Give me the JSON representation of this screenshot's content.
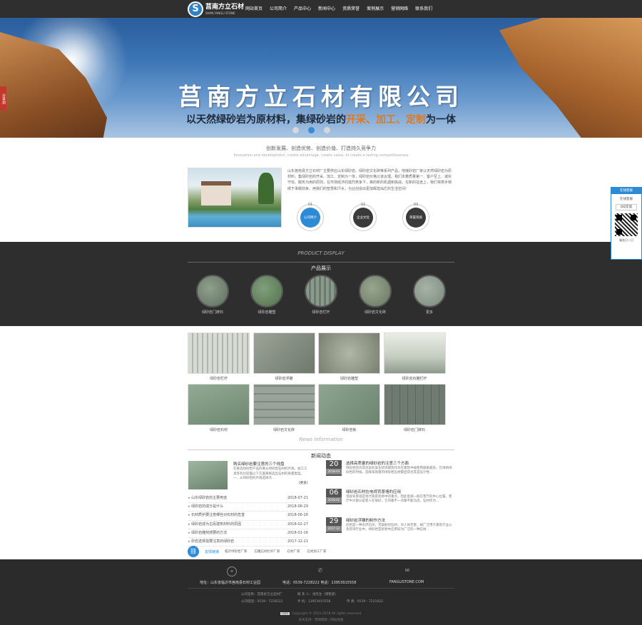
{
  "header": {
    "logo_cn": "莒南方立石材",
    "logo_en": "SHAN FANGLI STONE",
    "logo_mark": "S",
    "nav": [
      "网站首页",
      "公司简介",
      "产品中心",
      "新闻中心",
      "资质荣誉",
      "案例展示",
      "营销网络",
      "联系我们"
    ]
  },
  "banner": {
    "title": "莒南方立石材有限公司",
    "sub_before": "以天然绿砂岩为原材料，集绿砂岩的",
    "sub_highlight": "开采、加工、定制",
    "sub_after": "为一体",
    "share_label": "分享到"
  },
  "slogan": {
    "cn": "创新发展、创造优势、创造价值、打造持久竞争力",
    "en": "Innovation and development, create advantage, create value, to create a lasting competitiveness"
  },
  "about": {
    "text": "山东莒南县方立石材厂主要供应山东绿砂岩、绿砂岩文化砖等系列产品，地接砂岩厂家以天然绿砂岩为原材料，集绿砂岩的开采、加工、定制为一体，绿砂岩价格公道合理。我们本着质量第一、客户至上、诚实守信、服务为用的原则，在市场经济的激烈竞争下，离的新的机遇和挑战，在新的征途上，我们将携手锦绣于事眼前争，用我们的智慧和汗水，为业创造出更加辉煌灿烂的生活空间!",
    "circles": [
      {
        "num": "01",
        "label": "公司简介"
      },
      {
        "num": "02",
        "label": "企业文化"
      },
      {
        "num": "03",
        "label": "荣誉资质"
      }
    ]
  },
  "products": {
    "title_en": "PRODUCT DISPLAY",
    "title_cn": "产品展示",
    "items": [
      "绿砂岩门牌石",
      "绿砂岩雕塑",
      "绿砂岩栏杆",
      "绿砂岩文化砖",
      "更多"
    ]
  },
  "gallery": {
    "items": [
      "绿砂岩栏杆",
      "绿砂岩浮雕",
      "绿砂岩雕塑",
      "绿砂岩石雕栏杆",
      "绿砂岩石材",
      "绿砂岩文化砖",
      "绿砂岩板",
      "绿砂岩门牌石"
    ]
  },
  "news": {
    "title_en": "News information",
    "title_cn": "新闻动态",
    "featured": {
      "title": "购买绿砂岩要注意的三个线盘",
      "text": "在挑选绿砂岩产品的要从绿砂岩石材的外观、加工工具等有比较面以下方面来挑选出石材的质量类型。一、从绿砂岩的外观选择点...",
      "more": "[更多]"
    },
    "list": [
      {
        "title": "山东绿砂岩的主要用途",
        "date": "2018-07-21"
      },
      {
        "title": "绿砂岩的成分是什么",
        "date": "2018-06-29"
      },
      {
        "title": "石材质护要注意哪些对石材的危害",
        "date": "2018-06-16"
      },
      {
        "title": "绿砂岩成为古民建筑材料的原因",
        "date": "2018-02-27"
      },
      {
        "title": "绿砂岩雕刻感要的方法",
        "date": "2018-01-16"
      },
      {
        "title": "砂岩选择需要注意的绿砂岩",
        "date": "2017-12-21"
      }
    ],
    "dated": [
      {
        "day": "20",
        "month": "2018-03",
        "title": "选择高质量的绿砂岩的注意三个方面",
        "text": "绿砂岩因为其优良的美化装饰建筑作为在建筑中被使用越来越多。在采购绿砂岩的时候，选择某质量的绿砂岩石材都显得尤其是设计性..."
      },
      {
        "day": "06",
        "month": "2018-02",
        "title": "绿砂岩石材在电视背景墙的应用",
        "text": "电视背景墙是现代家庭装修中的重点，因此电视一般在客厅的中心位置。客厅中大部分是客人在很好，它的都不一点都不能马虎。石材作为..."
      },
      {
        "day": "29",
        "month": "2017-12",
        "title": "绿砂岩浮雕的制作方法",
        "text": "砂岩是一种天然石块，无辐射的石材，对人体无害，被广泛用于建筑行业以及装饰行业中。绿砂岩是砂岩中应用较为广泛的一种石材..."
      }
    ]
  },
  "friends": {
    "label": "友情链接",
    "icon": "⛓",
    "links": [
      "临沂绿砂岩厂家",
      "石雕石材栏杆厂家",
      "石材厂家",
      "石材加工厂家"
    ]
  },
  "footer": {
    "address": "地址：山东省临沂市莒南县石材工业园",
    "phone": "电话：0539-7228222 电话：13953915558",
    "site": "FANGLISTONE.COM",
    "company": "公司名称：莒南县方立石材厂",
    "contact": "联 系 人：张先生（销售部）",
    "tel": "公司电话：0539 - 7228222",
    "mobile": "手 机：13953915558",
    "fax": "传 真：0539 - 7221022",
    "badge": "CNZZ",
    "copyright": "Copyright © 2015-2018 All rights reserved.",
    "support": "技术支持：营销网络 | 网站地图",
    "icons": [
      "⌖",
      "✆",
      "✉"
    ]
  },
  "float": {
    "head": "在线客服",
    "sub": "在线客服",
    "qq": "QQ交谈",
    "time": "服务日一日"
  }
}
